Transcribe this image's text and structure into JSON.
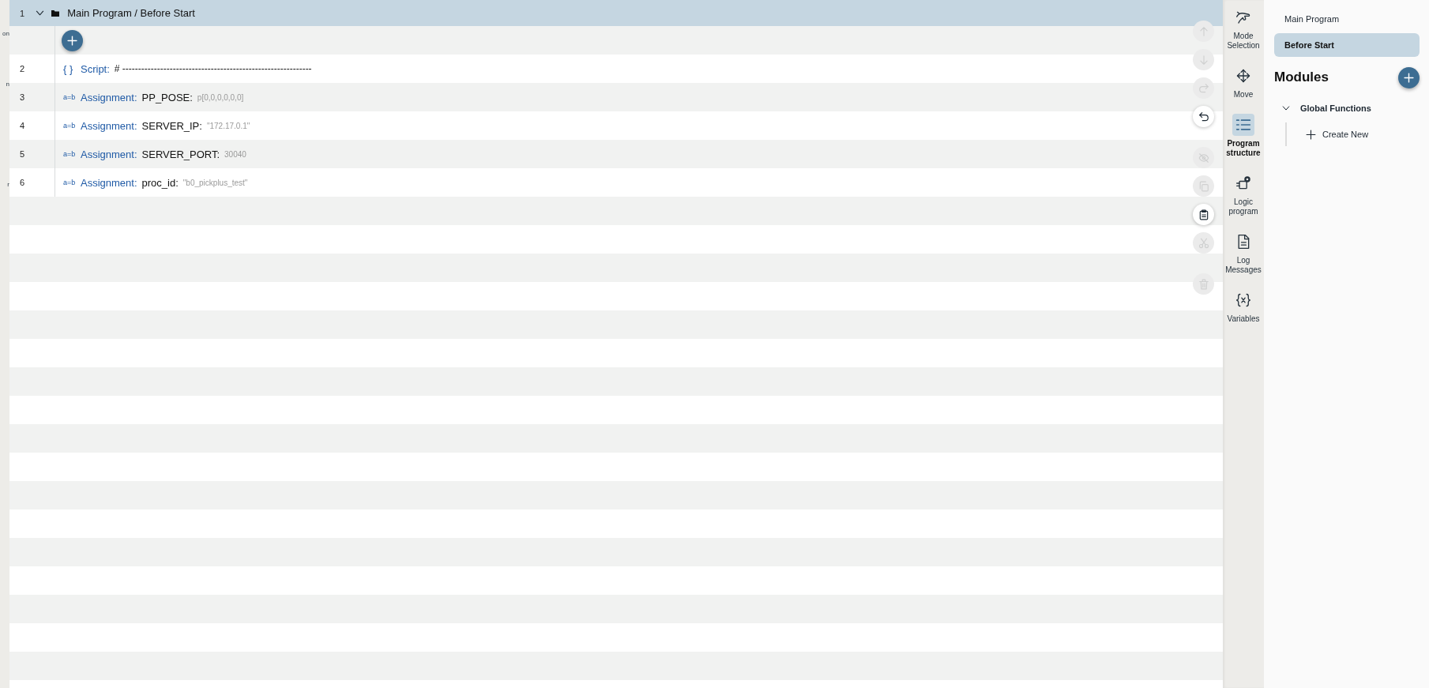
{
  "left_edge": {
    "labels": [
      "on",
      "n",
      "r"
    ]
  },
  "program": {
    "header": {
      "line": "1",
      "expanded": true,
      "title": "Main Program / Before Start"
    },
    "rows": [
      {
        "line": "2",
        "kind": "script",
        "symbol": "{ }",
        "label": "Script:",
        "value": "# ------------------------------------------------------------"
      },
      {
        "line": "3",
        "kind": "assignment",
        "symbol": "a=b",
        "label": "Assignment:",
        "variable": "PP_POSE:",
        "value": "p[0,0,0,0,0,0]"
      },
      {
        "line": "4",
        "kind": "assignment",
        "symbol": "a=b",
        "label": "Assignment:",
        "variable": "SERVER_IP:",
        "value": "\"172.17.0.1\""
      },
      {
        "line": "5",
        "kind": "assignment",
        "symbol": "a=b",
        "label": "Assignment:",
        "variable": "SERVER_PORT:",
        "value": "30040"
      },
      {
        "line": "6",
        "kind": "assignment",
        "symbol": "a=b",
        "label": "Assignment:",
        "variable": "proc_id:",
        "value": "\"b0_pickplus_test\""
      }
    ]
  },
  "toolbar_groups": [
    [
      {
        "kind": "up",
        "disabled": true
      },
      {
        "kind": "down",
        "disabled": true
      },
      {
        "kind": "redo",
        "disabled": true
      },
      {
        "kind": "undo",
        "disabled": false
      }
    ],
    [
      {
        "kind": "hide",
        "disabled": true
      },
      {
        "kind": "copy",
        "disabled": true
      },
      {
        "kind": "paste",
        "disabled": false
      },
      {
        "kind": "cut",
        "disabled": true
      }
    ],
    [
      {
        "kind": "delete",
        "disabled": true
      }
    ]
  ],
  "nav": [
    {
      "kind": "mode",
      "label": "Mode Selection",
      "selected": false
    },
    {
      "kind": "move",
      "label": "Move",
      "selected": false
    },
    {
      "kind": "structure",
      "label": "Program structure",
      "selected": true
    },
    {
      "kind": "logic",
      "label": "Logic program",
      "selected": false
    },
    {
      "kind": "log",
      "label": "Log Messages",
      "selected": false
    },
    {
      "kind": "variables",
      "label": "Variables",
      "selected": false
    }
  ],
  "side_panel": {
    "items": [
      {
        "label": "Main Program",
        "selected": false
      },
      {
        "label": "Before Start",
        "selected": true
      }
    ],
    "modules": {
      "title": "Modules"
    },
    "tree": [
      {
        "label": "Global Functions",
        "expanded": true,
        "children": [
          {
            "kind": "create",
            "label": "Create New"
          }
        ]
      }
    ]
  }
}
